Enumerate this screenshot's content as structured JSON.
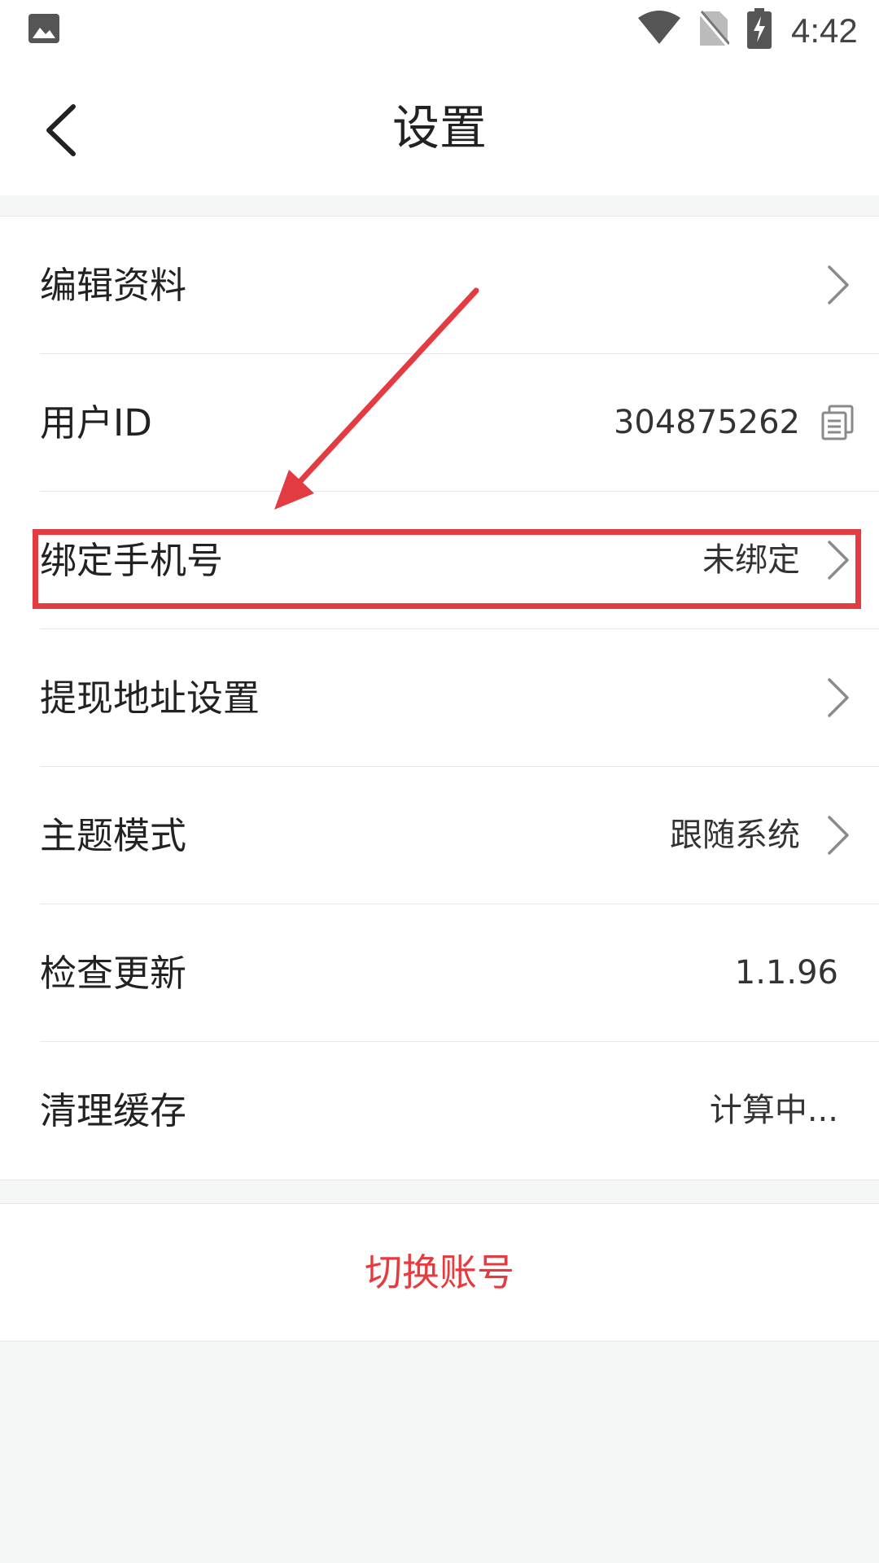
{
  "status_bar": {
    "time": "4:42",
    "icons": [
      "gallery-icon",
      "wifi-icon",
      "no-sim-icon",
      "battery-charging-icon"
    ]
  },
  "header": {
    "title": "设置",
    "back_icon": "chevron-left-icon"
  },
  "menu": {
    "items": [
      {
        "label": "编辑资料",
        "value": "",
        "icon": "chevron-right-icon"
      },
      {
        "label": "用户ID",
        "value": "304875262",
        "icon": "copy-icon"
      },
      {
        "label": "绑定手机号",
        "value": "未绑定",
        "icon": "chevron-right-icon"
      },
      {
        "label": "提现地址设置",
        "value": "",
        "icon": "chevron-right-icon"
      },
      {
        "label": "主题模式",
        "value": "跟随系统",
        "icon": "chevron-right-icon"
      },
      {
        "label": "检查更新",
        "value": "1.1.96",
        "icon": ""
      },
      {
        "label": "清理缓存",
        "value": "计算中...",
        "icon": ""
      }
    ]
  },
  "actions": {
    "switch_account": "切换账号"
  },
  "colors": {
    "accent_red": "#e63b3e",
    "annotation_red": "#e23b41",
    "background": "#f5f6f6"
  }
}
